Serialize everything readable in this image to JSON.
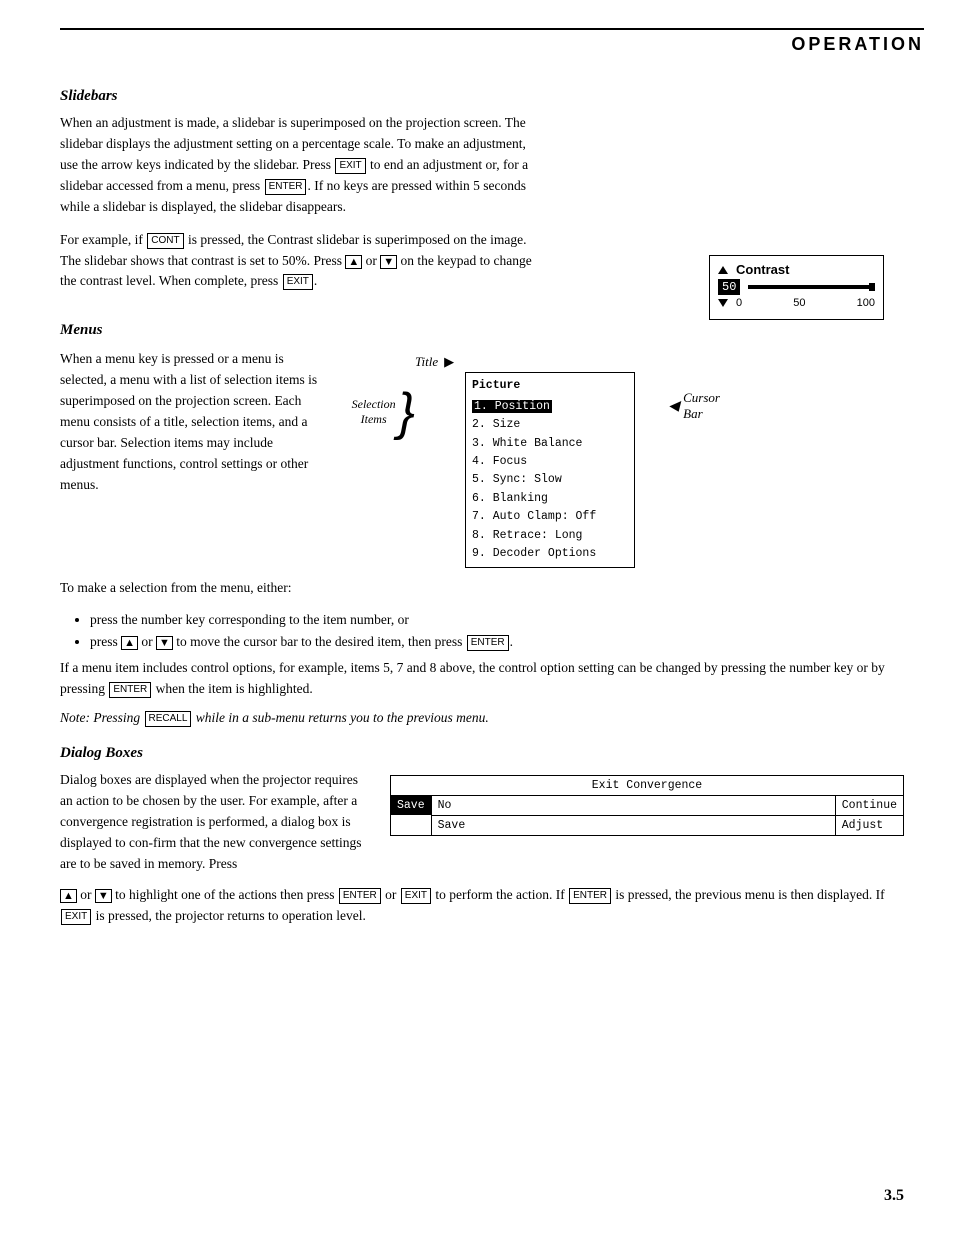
{
  "header": {
    "title": "OPERATION"
  },
  "slidebars": {
    "heading": "Slidebars",
    "para1": "When an adjustment is made, a slidebar is superimposed on the projection screen. The slidebar displays the adjustment setting on a percentage scale. To make an adjustment, use the arrow keys indicated by the slidebar. Press",
    "key_exit": "EXIT",
    "para1b": "to end an adjustment or, for a slidebar accessed from a menu, press",
    "key_enter": "ENTER",
    "para1c": ". If no keys are pressed within 5 seconds while a slidebar is displayed, the slidebar disappears.",
    "para2a": "For example, if",
    "key_cont": "CONT",
    "para2b": "is pressed, the Contrast slidebar is superimposed on the image. The slidebar shows that contrast is set to 50%. Press",
    "key_up": "▲",
    "para2c": "or",
    "key_dn": "▼",
    "para2d": "on the keypad to change the contrast level. When complete, press",
    "key_exit2": "EXIT",
    "para2e": ".",
    "contrast_box": {
      "title": "Contrast",
      "value": "50",
      "scale_min": "0",
      "scale_mid": "50",
      "scale_max": "100"
    }
  },
  "menus": {
    "heading": "Menus",
    "body_text": "When a menu key is pressed or a menu is selected, a menu with a list of selection items is superimposed on the projection screen. Each menu consists of a title, selection items, and a cursor bar. Selection items may include adjustment functions, control settings or other menus.",
    "diagram": {
      "title_label": "Title",
      "title_arrow": "▶",
      "menu_title": "Picture",
      "items": [
        "1. Position",
        "2. Size",
        "3. White Balance",
        "4. Focus",
        "5. Sync: Slow",
        "6. Blanking",
        "7. Auto Clamp: Off",
        "8. Retrace: Long",
        "9. Decoder Options"
      ],
      "highlighted_item": "1. Position",
      "cursor_bar_label": "Cursor\nBar",
      "cursor_bar_arrow": "◀",
      "selection_label": "Selection\nItems"
    },
    "para_after": "To make a selection from the menu, either:",
    "bullets": [
      "press the number key corresponding to the item number, or",
      "press ▲ or ▼ to move the cursor bar to the desired item, then press ENTER."
    ],
    "para2": "If a menu item includes control options, for example, items 5, 7 and 8 above, the control option setting can be changed by pressing the number key or by pressing",
    "key_enter": "ENTER",
    "para2b": "when the item is highlighted.",
    "note": "Note: Pressing",
    "key_recall": "RECALL",
    "note_b": "while in a sub-menu returns you to the previous menu."
  },
  "dialog_boxes": {
    "heading": "Dialog Boxes",
    "para1": "Dialog boxes are displayed when the projector requires an action to be chosen by the user. For example, after a convergence registration is performed, a dialog box is displayed to con-firm that the new convergence settings are to be saved in memory. Press",
    "key_up": "▲",
    "para1b": "or",
    "key_dn": "▼",
    "para1c": "to highlight one of the actions then press",
    "key_enter": "ENTER",
    "para1d": "or",
    "key_exit": "EXIT",
    "para1e": "to perform the action. If",
    "key_enter2": "ENTER",
    "para1f": "is pressed, the previous menu is then displayed. If",
    "key_exit2": "EXIT",
    "para1g": "is pressed, the projector returns to operation level.",
    "dialog_box": {
      "title": "Exit Convergence",
      "save_btn": "Save",
      "no_btn": "No",
      "continue_btn": "Continue",
      "save2_btn": "Save",
      "adjust_btn": "Adjust"
    }
  },
  "page_number": "3.5"
}
